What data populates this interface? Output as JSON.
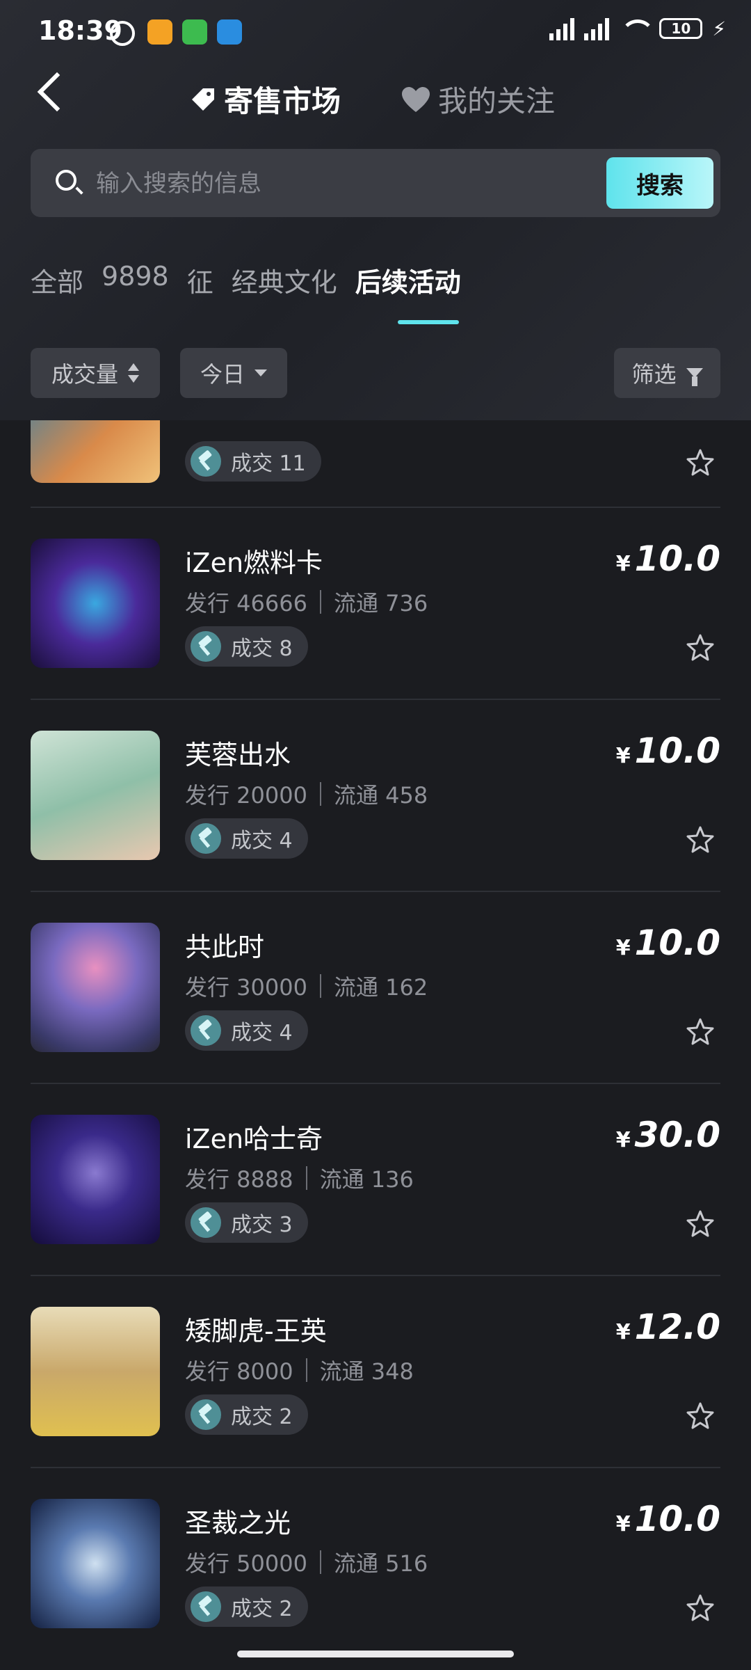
{
  "status_bar": {
    "time": "18:39",
    "battery": "10"
  },
  "nav": {
    "market_label": "寄售市场",
    "follow_label": "我的关注"
  },
  "search": {
    "placeholder": "输入搜索的信息",
    "button_label": "搜索"
  },
  "category_tabs": [
    "全部",
    "9898",
    "征",
    "经典文化",
    "后续活动"
  ],
  "active_category": "后续活动",
  "filters": {
    "sort_label": "成交量",
    "period_label": "今日",
    "screen_label": "筛选"
  },
  "labels": {
    "issue_prefix": "发行",
    "circulation_prefix": "流通",
    "deal_prefix": "成交",
    "currency": "¥"
  },
  "items": [
    {
      "title": "",
      "issue": "",
      "circulation": "",
      "deals": "11",
      "price": "",
      "deal_text": "成交 11"
    },
    {
      "title": "iZen燃料卡",
      "issue_text": "发行 46666",
      "circulation_text": "流通 736",
      "deal_text": "成交 8",
      "price": "10.0"
    },
    {
      "title": "芙蓉出水",
      "issue_text": "发行 20000",
      "circulation_text": "流通 458",
      "deal_text": "成交 4",
      "price": "10.0"
    },
    {
      "title": "共此时",
      "issue_text": "发行 30000",
      "circulation_text": "流通 162",
      "deal_text": "成交 4",
      "price": "10.0"
    },
    {
      "title": "iZen哈士奇",
      "issue_text": "发行 8888",
      "circulation_text": "流通 136",
      "deal_text": "成交 3",
      "price": "30.0"
    },
    {
      "title": "矮脚虎-王英",
      "issue_text": "发行 8000",
      "circulation_text": "流通 348",
      "deal_text": "成交 2",
      "price": "12.0"
    },
    {
      "title": "圣裁之光",
      "issue_text": "发行 50000",
      "circulation_text": "流通 516",
      "deal_text": "成交 2",
      "price": "10.0"
    }
  ],
  "thumb_colors": [
    "#c97a3a",
    "#3a1f7a",
    "#a9c8b8",
    "#6a5a9a",
    "#231f5a",
    "#c9b48a",
    "#1d2c4a"
  ]
}
